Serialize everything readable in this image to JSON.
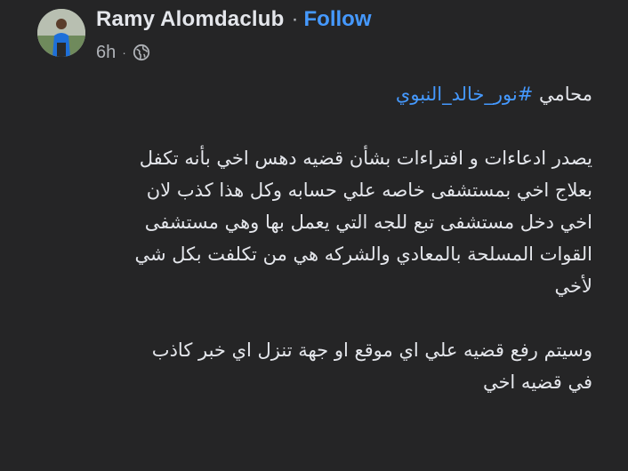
{
  "post": {
    "author": "Ramy Alomdaclub",
    "separator": "·",
    "follow_label": "Follow",
    "timestamp": "6h",
    "meta_separator": "·",
    "audience_icon": "globe-icon",
    "avatar_icon": "avatar",
    "body": {
      "intro_text": "محامي",
      "hashtag": "#نور_خالد_النبوي",
      "lines": [
        "يصدر ادعاءات و افتراءات بشأن قضيه دهس اخي بأنه تكفل",
        "بعلاج اخي بمستشفى خاصه علي حسابه وكل هذا كذب لان",
        "اخي دخل مستشفى تبع للجه التي يعمل بها وهي مستشفى",
        "القوات المسلحة بالمعادي والشركه هي من تكلفت بكل شي",
        "لأخي"
      ],
      "closing_lines": [
        "وسيتم رفع قضيه علي اي موقع او جهة تنزل اي خبر كاذب",
        "في قضيه اخي"
      ]
    },
    "colors": {
      "background": "#252526",
      "text": "#e4e6eb",
      "muted": "#b0b3b8",
      "link": "#4599ff"
    }
  }
}
